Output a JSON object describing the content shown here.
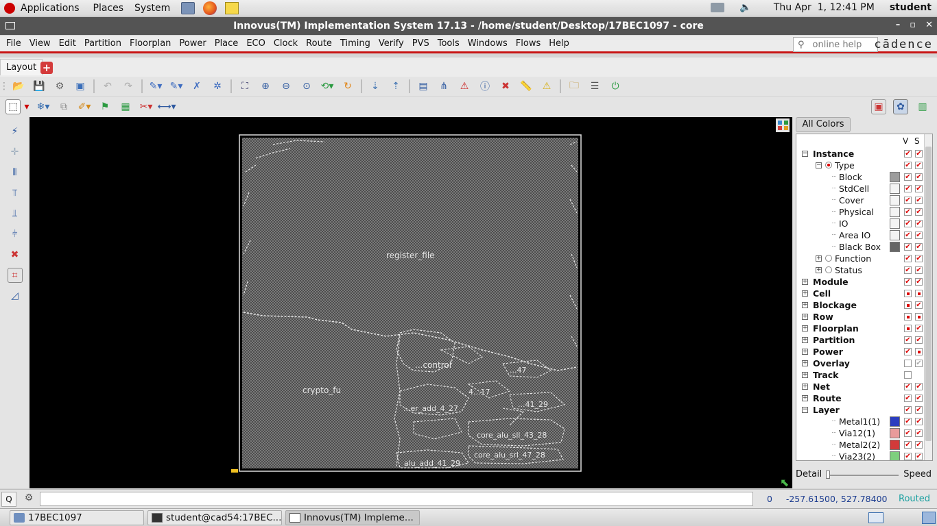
{
  "gnome_panel": {
    "menus": [
      "Applications",
      "Places",
      "System"
    ],
    "clock": "Thu Apr  1, 12:41 PM",
    "user": "student"
  },
  "window": {
    "title": "Innovus(TM) Implementation System 17.13 - /home/student/Desktop/17BEC1097 - core",
    "controls": [
      "–",
      "▫",
      "✕"
    ]
  },
  "menubar": {
    "items": [
      "File",
      "View",
      "Edit",
      "Partition",
      "Floorplan",
      "Power",
      "Place",
      "ECO",
      "Clock",
      "Route",
      "Timing",
      "Verify",
      "PVS",
      "Tools",
      "Windows",
      "Flows",
      "Help"
    ],
    "search_placeholder": "online help",
    "brand": "cādence"
  },
  "tabs": {
    "active": "Layout",
    "add_icon": "plus-icon"
  },
  "layout": {
    "labels": {
      "register_file": "register_file",
      "crypto_fu": "crypto_fu",
      "control": "...control",
      "adder": "...er_add_4_27",
      "alu_sll_43": "core_alu_sll_43_28",
      "alu_srl_47": "core_alu_srl_47_28",
      "alu_add_41": "alu_add_41_29",
      "small_a": "...47",
      "small_b": "4...17",
      "small_c": "...41_29"
    }
  },
  "right_panel": {
    "all_colors": "All Colors",
    "col_v": "V",
    "col_s": "S",
    "tree": [
      {
        "label": "Instance",
        "level": 0,
        "bold": true,
        "exp": "−",
        "v": "check",
        "s": "check"
      },
      {
        "label": "Type",
        "level": 1,
        "bold": false,
        "exp": "−",
        "v": "check",
        "s": "check",
        "radio": true
      },
      {
        "label": "Block",
        "level": 2,
        "bold": false,
        "swatch": "#9d9d9d",
        "v": "check",
        "s": "check"
      },
      {
        "label": "StdCell",
        "level": 2,
        "bold": false,
        "swatch": "#f4f4f4",
        "v": "check",
        "s": "check"
      },
      {
        "label": "Cover",
        "level": 2,
        "bold": false,
        "swatch": "#f4f4f4",
        "v": "check",
        "s": "check"
      },
      {
        "label": "Physical",
        "level": 2,
        "bold": false,
        "swatch": "#f4f4f4",
        "v": "check",
        "s": "check"
      },
      {
        "label": "IO",
        "level": 2,
        "bold": false,
        "swatch": "#f4f4f4",
        "v": "check",
        "s": "check"
      },
      {
        "label": "Area IO",
        "level": 2,
        "bold": false,
        "swatch": "#f4f4f4",
        "v": "check",
        "s": "check"
      },
      {
        "label": "Black Box",
        "level": 2,
        "bold": false,
        "swatch": "#666666",
        "v": "check",
        "s": "check"
      },
      {
        "label": "Function",
        "level": 1,
        "bold": false,
        "exp": "+",
        "v": "check",
        "s": "check",
        "radio": true
      },
      {
        "label": "Status",
        "level": 1,
        "bold": false,
        "exp": "+",
        "v": "check",
        "s": "check",
        "radio": true
      },
      {
        "label": "Module",
        "level": 0,
        "bold": true,
        "exp": "+",
        "v": "check",
        "s": "check"
      },
      {
        "label": "Cell",
        "level": 0,
        "bold": true,
        "exp": "+",
        "v": "square",
        "s": "square"
      },
      {
        "label": "Blockage",
        "level": 0,
        "bold": true,
        "exp": "+",
        "v": "square",
        "s": "check"
      },
      {
        "label": "Row",
        "level": 0,
        "bold": true,
        "exp": "+",
        "v": "square",
        "s": "square"
      },
      {
        "label": "Floorplan",
        "level": 0,
        "bold": true,
        "exp": "+",
        "v": "square",
        "s": "check"
      },
      {
        "label": "Partition",
        "level": 0,
        "bold": true,
        "exp": "+",
        "v": "check",
        "s": "check"
      },
      {
        "label": "Power",
        "level": 0,
        "bold": true,
        "exp": "+",
        "v": "check",
        "s": "square"
      },
      {
        "label": "Overlay",
        "level": 0,
        "bold": true,
        "exp": "+",
        "v": "empty",
        "s": "grey"
      },
      {
        "label": "Track",
        "level": 0,
        "bold": true,
        "exp": "+",
        "v": "empty",
        "s": "none"
      },
      {
        "label": "Net",
        "level": 0,
        "bold": true,
        "exp": "+",
        "v": "check",
        "s": "check"
      },
      {
        "label": "Route",
        "level": 0,
        "bold": true,
        "exp": "+",
        "v": "check",
        "s": "check"
      },
      {
        "label": "Layer",
        "level": 0,
        "bold": true,
        "exp": "−",
        "v": "check",
        "s": "check"
      },
      {
        "label": "Metal1(1)",
        "level": 2,
        "bold": false,
        "swatch": "#2b3dbf",
        "v": "check",
        "s": "check"
      },
      {
        "label": "Via12(1)",
        "level": 2,
        "bold": false,
        "swatch": "#e89b9b",
        "v": "check",
        "s": "check"
      },
      {
        "label": "Metal2(2)",
        "level": 2,
        "bold": false,
        "swatch": "#d23a3a",
        "v": "check",
        "s": "check"
      },
      {
        "label": "Via23(2)",
        "level": 2,
        "bold": false,
        "swatch": "#7ecf7e",
        "v": "check",
        "s": "check"
      }
    ],
    "detail_label": "Detail",
    "speed_label": "Speed",
    "detail_speed": 0.0
  },
  "statusbar": {
    "q_label": "Q",
    "count": "0",
    "coords": "-257.61500, 527.78400",
    "state": "Routed"
  },
  "taskbar": {
    "items": [
      {
        "label": "17BEC1097",
        "icon": "folder-icon",
        "active": false
      },
      {
        "label": "student@cad54:17BEC...",
        "icon": "terminal-icon",
        "active": false
      },
      {
        "label": "Innovus(TM) Impleme...",
        "icon": "window-icon",
        "active": true
      }
    ]
  },
  "colors": {
    "accent_red": "#c81414",
    "title_bar": "#545454",
    "canvas": "#000000",
    "routed": "#1aa0a0"
  }
}
